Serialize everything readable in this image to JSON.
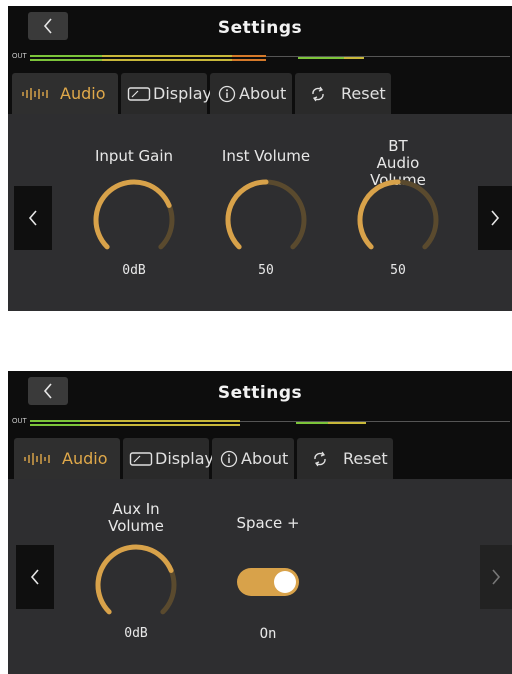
{
  "colors": {
    "accent": "#d8a24a",
    "panel_bg": "#1a1a1a",
    "content_bg": "#2e2e30",
    "meter_green": "#7cc43a",
    "meter_yellow": "#c8b83a",
    "meter_orange": "#d67a2a"
  },
  "screens": [
    {
      "title": "Settings",
      "meter_label": "OUT",
      "tabs": [
        {
          "label": "Audio",
          "icon": "audio-waveform-icon",
          "active": true
        },
        {
          "label": "Display",
          "icon": "display-icon",
          "active": false
        },
        {
          "label": "About",
          "icon": "info-icon",
          "active": false
        },
        {
          "label": "Reset",
          "icon": "reset-arrows-icon",
          "active": false
        }
      ],
      "knobs": [
        {
          "label": "Input Gain",
          "value": "0dB",
          "level": 0.75
        },
        {
          "label": "Inst Volume",
          "value": "50",
          "level": 0.5
        },
        {
          "label": "BT Audio Volume",
          "value": "50",
          "level": 0.5
        }
      ]
    },
    {
      "title": "Settings",
      "meter_label": "OUT",
      "tabs": [
        {
          "label": "Audio",
          "icon": "audio-waveform-icon",
          "active": true
        },
        {
          "label": "Display",
          "icon": "display-icon",
          "active": false
        },
        {
          "label": "About",
          "icon": "info-icon",
          "active": false
        },
        {
          "label": "Reset",
          "icon": "reset-arrows-icon",
          "active": false
        }
      ],
      "knobs": [
        {
          "label": "Aux In Volume",
          "value": "0dB",
          "level": 0.75
        }
      ],
      "toggle": {
        "label": "Space +",
        "value": "On",
        "on": true
      }
    }
  ]
}
